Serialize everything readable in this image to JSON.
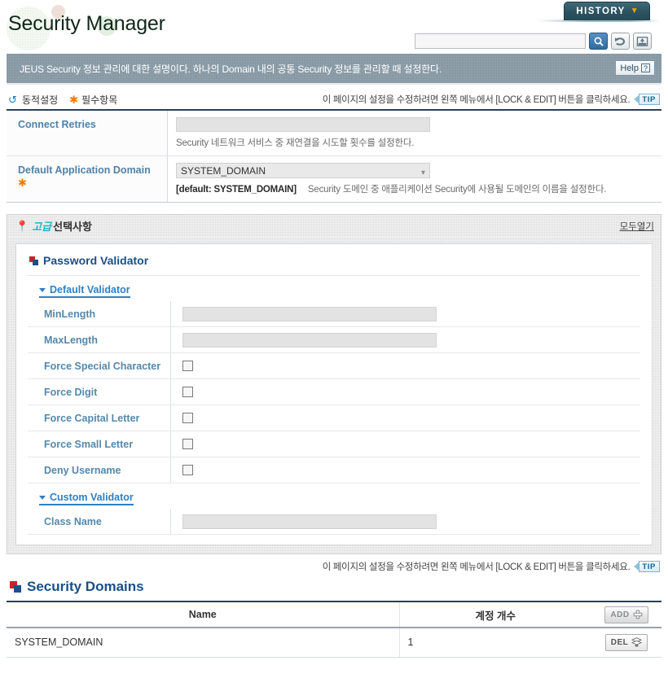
{
  "header": {
    "app_title": "Security Manager",
    "history_label": "HISTORY",
    "history_chevron": "chevron-down-icon",
    "search_value": "",
    "search_placeholder": "",
    "search_icon": "search-icon",
    "refresh_icon": "refresh-icon",
    "xml_icon": "xml-export-icon"
  },
  "description": {
    "text": "JEUS Security 정보 관리에 대한 설명이다. 하나의 Domain 내의 공통 Security 정보를 관리할 때 설정한다.",
    "help_label": "Help",
    "help_mark": "?"
  },
  "legend": {
    "dynamic_label": "동적설정",
    "required_label": "필수항목",
    "lock_note": "이 페이지의 설정을 수정하려면 왼쪽 메뉴에서 [LOCK & EDIT] 버튼을 클릭하세요.",
    "tip_label": "TIP"
  },
  "form": {
    "rows": [
      {
        "label": "Connect Retries",
        "required": false,
        "type": "text",
        "value": "",
        "hint_default": "",
        "hint": "Security 네트워크 서비스 중 재연결을 시도할 횟수를 설정한다."
      },
      {
        "label": "Default Application Domain",
        "required": true,
        "type": "select",
        "value": "SYSTEM_DOMAIN",
        "hint_default": "[default: SYSTEM_DOMAIN]",
        "hint": "Security 도메인 중 애플리케이션 Security에 사용될 도메인의 이름을 설정한다."
      }
    ]
  },
  "advanced": {
    "badge_ko": "고급",
    "title_ko": "선택사항",
    "open_all": "모두열기",
    "password_validator_title": "Password Validator",
    "default_validator_label": "Default Validator",
    "custom_validator_label": "Custom Validator",
    "default_rows": [
      {
        "label": "MinLength",
        "type": "text",
        "value": ""
      },
      {
        "label": "MaxLength",
        "type": "text",
        "value": ""
      },
      {
        "label": "Force Special Character",
        "type": "checkbox",
        "checked": false
      },
      {
        "label": "Force Digit",
        "type": "checkbox",
        "checked": false
      },
      {
        "label": "Force Capital Letter",
        "type": "checkbox",
        "checked": false
      },
      {
        "label": "Force Small Letter",
        "type": "checkbox",
        "checked": false
      },
      {
        "label": "Deny Username",
        "type": "checkbox",
        "checked": false
      }
    ],
    "custom_rows": [
      {
        "label": "Class Name",
        "type": "text",
        "value": ""
      }
    ]
  },
  "bottom": {
    "lock_note": "이 페이지의 설정을 수정하려면 왼쪽 메뉴에서 [LOCK & EDIT] 버튼을 클릭하세요.",
    "tip_label": "TIP",
    "section_title": "Security Domains",
    "columns": [
      "Name",
      "계정 개수",
      ""
    ],
    "add_label": "ADD",
    "del_label": "DEL",
    "rows": [
      {
        "name": "SYSTEM_DOMAIN",
        "count": "1",
        "action": "DEL"
      }
    ]
  },
  "colors": {
    "accent_blue": "#1b4f86",
    "label_blue": "#4e82a8",
    "required_orange": "#f07c00",
    "advanced_cyan": "#1fb5c9",
    "banner_gray": "#7e919d",
    "history_teal": "#2c5260"
  }
}
